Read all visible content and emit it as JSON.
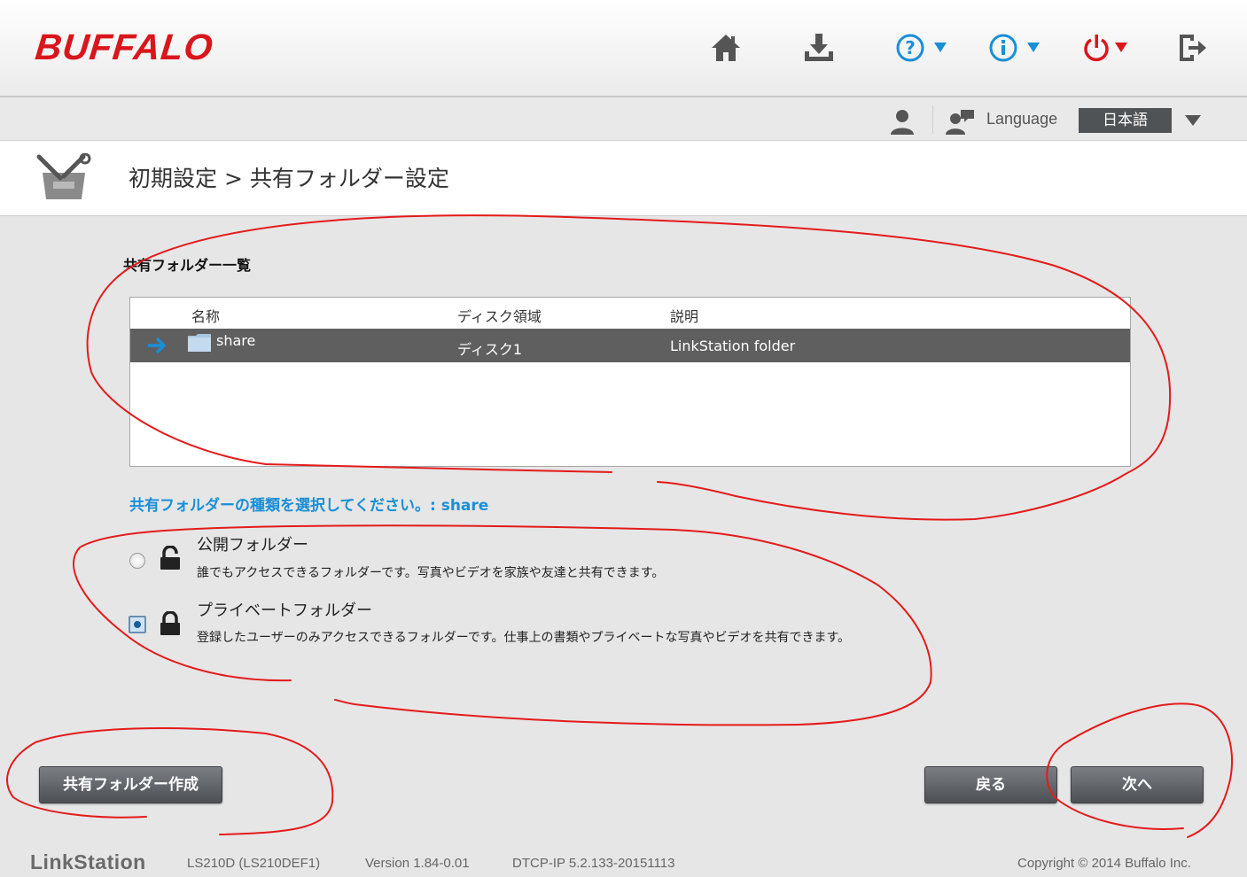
{
  "header": {
    "brand": "BUFFALO",
    "icons": [
      "home-icon",
      "download-icon",
      "help-icon",
      "info-icon",
      "power-icon",
      "logout-icon"
    ],
    "accent_color": "#d9161c",
    "icon_blue": "#1a8fd6"
  },
  "subbar": {
    "language_label": "Language",
    "language_value": "日本語"
  },
  "page": {
    "title": "初期設定 > 共有フォルダー設定"
  },
  "folder_list": {
    "label": "共有フォルダー一覧",
    "columns": [
      "名称",
      "ディスク領域",
      "説明"
    ],
    "rows": [
      {
        "name": "share",
        "disk": "ディスク1",
        "description": "LinkStation folder",
        "selected": true
      }
    ]
  },
  "folder_type": {
    "prompt": "共有フォルダーの種類を選択してください。: share",
    "options": [
      {
        "title": "公開フォルダー",
        "description": "誰でもアクセスできるフォルダーです。写真やビデオを家族や友達と共有できます。",
        "checked": false
      },
      {
        "title": "プライベートフォルダー",
        "description": "登録したユーザーのみアクセスできるフォルダーです。仕事上の書類やプライベートな写真やビデオを共有できます。",
        "checked": true
      }
    ]
  },
  "buttons": {
    "create": "共有フォルダー作成",
    "back": "戻る",
    "next": "次へ"
  },
  "footer": {
    "product": "LinkStation",
    "model": "LS210D (LS210DEF1)",
    "version": "Version 1.84-0.01",
    "dtcp": "DTCP-IP 5.2.133-20151113",
    "copyright": "Copyright © 2014 Buffalo Inc."
  }
}
